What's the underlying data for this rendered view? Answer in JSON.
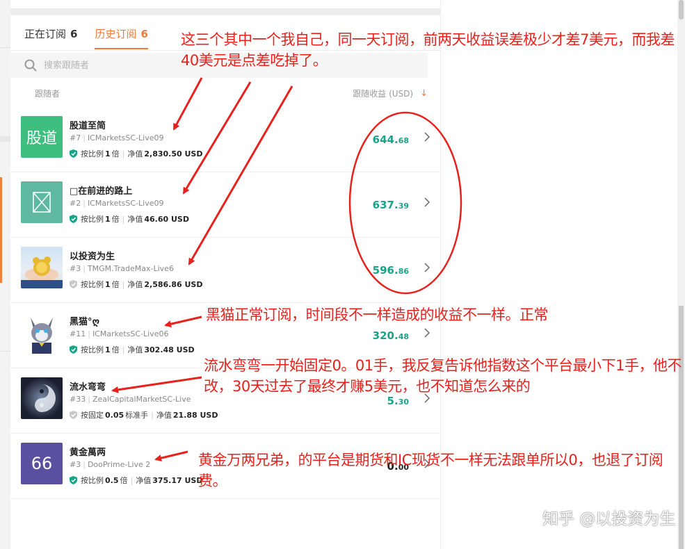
{
  "tabs": [
    {
      "label": "正在订阅",
      "count": "6"
    },
    {
      "label": "历史订阅",
      "count": "6"
    }
  ],
  "search": {
    "placeholder": "搜索跟随者"
  },
  "columns": {
    "follower": "跟随者",
    "profit": "跟随收益 (USD)",
    "sort_icon": "arrow-down-icon"
  },
  "rows": [
    {
      "name": "股道至简",
      "avatar_text": "股道",
      "rank": "#7",
      "broker": "ICMarketsSC-Live09",
      "mode": "按比例",
      "mult": "1",
      "unit": "倍",
      "equity_label": "净值",
      "equity": "2,830.50 USD",
      "profit_int": "644.",
      "profit_dec": "68",
      "verified": true
    },
    {
      "name": "□在前进的路上",
      "avatar_text": "",
      "rank": "#2",
      "broker": "ICMarketsSC-Live09",
      "mode": "按比例",
      "mult": "1",
      "unit": "倍",
      "equity_label": "净值",
      "equity": "46.60 USD",
      "profit_int": "637.",
      "profit_dec": "39",
      "verified": true
    },
    {
      "name": "以投资为生",
      "avatar_text": "",
      "rank": "#3",
      "broker": "TMGM.TradeMax-Live6",
      "mode": "按比例",
      "mult": "1",
      "unit": "倍",
      "equity_label": "净值",
      "equity": "2,586.86 USD",
      "profit_int": "596.",
      "profit_dec": "86",
      "verified": false
    },
    {
      "name": "黑猫°ღ",
      "avatar_text": "",
      "rank": "#11",
      "broker": "ICMarketsSC-Live06",
      "mode": "按比例",
      "mult": "1",
      "unit": "倍",
      "equity_label": "净值",
      "equity": "302.48 USD",
      "profit_int": "320.",
      "profit_dec": "48",
      "verified": true
    },
    {
      "name": "流水弯弯",
      "avatar_text": "",
      "rank": "#33",
      "broker": "ZealCapitalMarketSC-Live",
      "mode": "按固定",
      "mult": "0.05",
      "unit": "标准手",
      "equity_label": "净值",
      "equity": "21.88 USD",
      "profit_int": "5.",
      "profit_dec": "30",
      "verified": false
    },
    {
      "name": "黄金萬两",
      "avatar_text": "66",
      "rank": "#3",
      "broker": "DooPrime-Live 2",
      "mode": "按比例",
      "mult": "0.5",
      "unit": "倍",
      "equity_label": "净值",
      "equity": "375.17 USD",
      "profit_int": "0.",
      "profit_dec": "00",
      "verified": true
    }
  ],
  "annotations": {
    "a1": "这三个其中一个我自己，同一天订阅，前两天收益误差极少才差7美元，而我差40美元是点差吃掉了。",
    "a2": "黑猫正常订阅，时间段不一样造成的收益不一样。正常",
    "a3": "流水弯弯一开始固定0。01手，我反复告诉他指数这个平台最小下1手，他不改，30天过去了最终才赚5美元，也不知道怎么来的",
    "a4": "黄金万两兄弟，的平台是期货和IC现货不一样无法跟单所以0，也退了订阅费。"
  },
  "watermark": "知乎 @以投资为生",
  "colors": {
    "accent": "#f07a3a",
    "profit": "#19a389",
    "annotation": "#e8211c",
    "avatar1": "#3fbf7f",
    "avatar2": "#5fb8a0",
    "avatar6": "#5b4fa0"
  }
}
